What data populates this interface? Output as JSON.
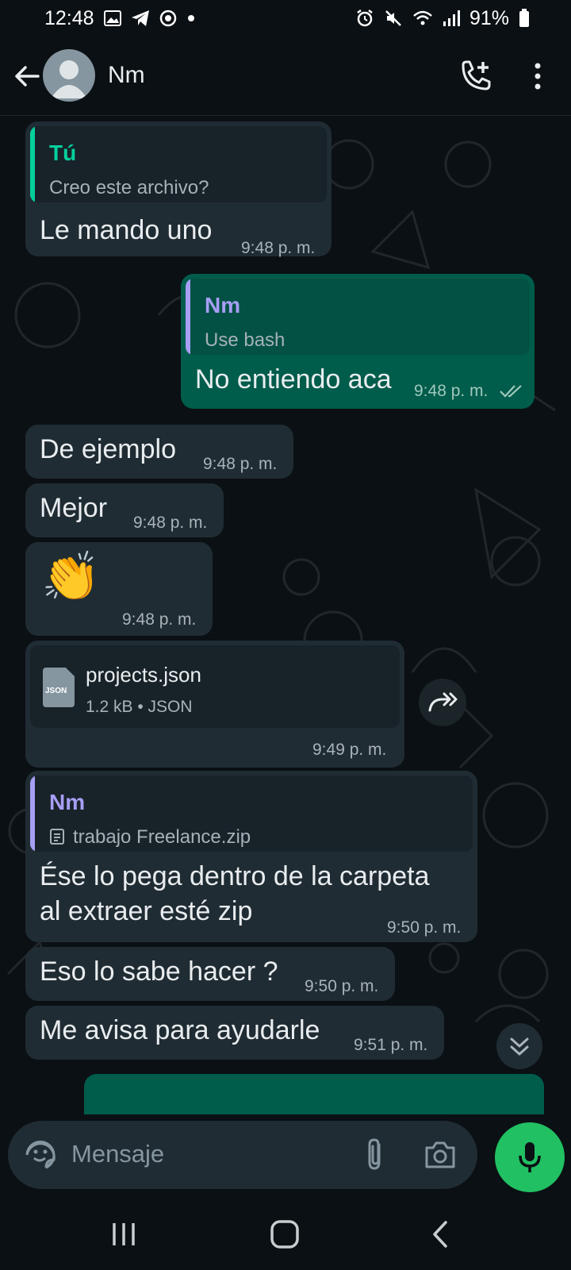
{
  "status": {
    "time": "12:48",
    "battery": "91%",
    "icons_left": [
      "gallery-icon",
      "telegram-icon",
      "vpn-icon",
      "dot-icon"
    ],
    "icons_right": [
      "alarm-icon",
      "mute-icon",
      "wifi-icon",
      "signal-icon",
      "battery-icon"
    ]
  },
  "header": {
    "contact_name": "Nm",
    "icons": [
      "back-arrow-icon",
      "avatar-icon",
      "add-call-icon",
      "more-vert-icon"
    ]
  },
  "messages": [
    {
      "direction": "in",
      "quote_name": "Tú",
      "quote_text": "Creo este archivo?",
      "text": "Le mando uno",
      "time": "9:48 p. m."
    },
    {
      "direction": "out",
      "quote_name": "Nm",
      "quote_text": "Use bash",
      "text": "No entiendo aca",
      "time": "9:48 p. m.",
      "status": "read-double-check"
    },
    {
      "direction": "in",
      "text": "De ejemplo",
      "time": "9:48 p. m."
    },
    {
      "direction": "in",
      "text": "Mejor",
      "time": "9:48 p. m."
    },
    {
      "direction": "in",
      "emoji": "👏",
      "time": "9:48 p. m."
    },
    {
      "direction": "in",
      "file_name": "projects.json",
      "file_meta": "1.2 kB • JSON",
      "file_icon_label": "JSON",
      "time": "9:49 p. m."
    },
    {
      "direction": "in",
      "quote_name": "Nm",
      "quote_text": "trabajo Freelance.zip",
      "text_line1": "Ése lo pega dentro de la carpeta",
      "text_line2": "al extraer esté zip",
      "time": "9:50 p. m."
    },
    {
      "direction": "in",
      "text": "Eso lo sabe hacer ?",
      "time": "9:50 p. m."
    },
    {
      "direction": "in",
      "text": "Me avisa para ayudarle",
      "time": "9:51 p. m."
    }
  ],
  "composer": {
    "placeholder": "Mensaje",
    "icons": [
      "emoji-sticker-icon",
      "attach-icon",
      "camera-icon",
      "mic-icon"
    ]
  },
  "colors": {
    "background": "#0b1014",
    "incoming_bubble": "#202c33",
    "outgoing_bubble": "#005c4b",
    "accent_green": "#21c063",
    "quote_green": "#06cf9c",
    "quote_purple": "#a79ef5"
  }
}
